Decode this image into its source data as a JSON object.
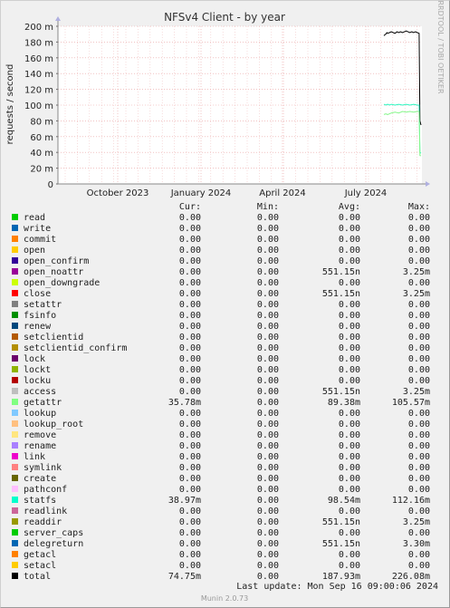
{
  "chart_data": {
    "type": "line",
    "title": "NFSv4 Client - by year",
    "ylabel": "requests / second",
    "side_label": "RRDTOOL / TOBI OETIKER",
    "ylim": [
      0,
      200
    ],
    "y_ticks": [
      "0",
      "20 m",
      "40 m",
      "60 m",
      "80 m",
      "100 m",
      "120 m",
      "140 m",
      "160 m",
      "180 m",
      "200 m"
    ],
    "x_ticks": [
      "October 2023",
      "January 2024",
      "April 2024",
      "July 2024"
    ],
    "grid": true,
    "series": [
      {
        "name": "total",
        "color": "#000000",
        "points": [
          [
            0.0,
            188
          ],
          [
            0.02,
            189
          ],
          [
            0.05,
            190
          ],
          [
            0.08,
            192
          ],
          [
            0.1,
            191
          ],
          [
            0.15,
            192
          ],
          [
            0.2,
            193
          ],
          [
            0.25,
            192
          ],
          [
            0.3,
            191
          ],
          [
            0.35,
            193
          ],
          [
            0.4,
            192
          ],
          [
            0.45,
            193
          ],
          [
            0.5,
            192
          ],
          [
            0.55,
            193
          ],
          [
            0.6,
            194
          ],
          [
            0.65,
            193
          ],
          [
            0.7,
            192
          ],
          [
            0.75,
            193
          ],
          [
            0.8,
            192
          ],
          [
            0.85,
            193
          ],
          [
            0.9,
            192
          ],
          [
            0.95,
            191
          ],
          [
            0.97,
            80
          ],
          [
            1.0,
            74.75
          ]
        ]
      },
      {
        "name": "statfs",
        "color": "#2cf6c0",
        "points": [
          [
            0.0,
            101
          ],
          [
            0.05,
            100
          ],
          [
            0.1,
            101
          ],
          [
            0.15,
            100
          ],
          [
            0.2,
            101
          ],
          [
            0.3,
            100
          ],
          [
            0.4,
            101
          ],
          [
            0.5,
            100
          ],
          [
            0.6,
            101
          ],
          [
            0.7,
            100
          ],
          [
            0.8,
            101
          ],
          [
            0.9,
            100
          ],
          [
            0.95,
            100
          ],
          [
            0.97,
            40
          ],
          [
            1.0,
            38.97
          ]
        ]
      },
      {
        "name": "getattr",
        "color": "#86f68a",
        "points": [
          [
            0.0,
            88
          ],
          [
            0.05,
            89
          ],
          [
            0.1,
            88
          ],
          [
            0.2,
            90
          ],
          [
            0.3,
            91
          ],
          [
            0.4,
            90
          ],
          [
            0.5,
            92
          ],
          [
            0.6,
            91
          ],
          [
            0.7,
            92
          ],
          [
            0.8,
            91
          ],
          [
            0.9,
            92
          ],
          [
            0.95,
            92
          ],
          [
            0.97,
            36
          ],
          [
            1.0,
            35.78
          ]
        ]
      }
    ],
    "legend_headers": [
      "Cur:",
      "Min:",
      "Avg:",
      "Max:"
    ],
    "legend": [
      {
        "name": "read",
        "color": "#00cc00",
        "cur": "0.00",
        "min": "0.00",
        "avg": "0.00",
        "max": "0.00"
      },
      {
        "name": "write",
        "color": "#0066b3",
        "cur": "0.00",
        "min": "0.00",
        "avg": "0.00",
        "max": "0.00"
      },
      {
        "name": "commit",
        "color": "#ff8000",
        "cur": "0.00",
        "min": "0.00",
        "avg": "0.00",
        "max": "0.00"
      },
      {
        "name": "open",
        "color": "#ffcc00",
        "cur": "0.00",
        "min": "0.00",
        "avg": "0.00",
        "max": "0.00"
      },
      {
        "name": "open_confirm",
        "color": "#330099",
        "cur": "0.00",
        "min": "0.00",
        "avg": "0.00",
        "max": "0.00"
      },
      {
        "name": "open_noattr",
        "color": "#990099",
        "cur": "0.00",
        "min": "0.00",
        "avg": "551.15n",
        "max": "3.25m"
      },
      {
        "name": "open_downgrade",
        "color": "#ccff00",
        "cur": "0.00",
        "min": "0.00",
        "avg": "0.00",
        "max": "0.00"
      },
      {
        "name": "close",
        "color": "#ff0000",
        "cur": "0.00",
        "min": "0.00",
        "avg": "551.15n",
        "max": "3.25m"
      },
      {
        "name": "setattr",
        "color": "#808080",
        "cur": "0.00",
        "min": "0.00",
        "avg": "0.00",
        "max": "0.00"
      },
      {
        "name": "fsinfo",
        "color": "#008f00",
        "cur": "0.00",
        "min": "0.00",
        "avg": "0.00",
        "max": "0.00"
      },
      {
        "name": "renew",
        "color": "#00487d",
        "cur": "0.00",
        "min": "0.00",
        "avg": "0.00",
        "max": "0.00"
      },
      {
        "name": "setclientid",
        "color": "#b35a00",
        "cur": "0.00",
        "min": "0.00",
        "avg": "0.00",
        "max": "0.00"
      },
      {
        "name": "setclientid_confirm",
        "color": "#b38f00",
        "cur": "0.00",
        "min": "0.00",
        "avg": "0.00",
        "max": "0.00"
      },
      {
        "name": "lock",
        "color": "#6b006b",
        "cur": "0.00",
        "min": "0.00",
        "avg": "0.00",
        "max": "0.00"
      },
      {
        "name": "lockt",
        "color": "#8fb300",
        "cur": "0.00",
        "min": "0.00",
        "avg": "0.00",
        "max": "0.00"
      },
      {
        "name": "locku",
        "color": "#b30000",
        "cur": "0.00",
        "min": "0.00",
        "avg": "0.00",
        "max": "0.00"
      },
      {
        "name": "access",
        "color": "#bebebe",
        "cur": "0.00",
        "min": "0.00",
        "avg": "551.15n",
        "max": "3.25m"
      },
      {
        "name": "getattr",
        "color": "#80ff80",
        "cur": "35.78m",
        "min": "0.00",
        "avg": "89.38m",
        "max": "105.57m"
      },
      {
        "name": "lookup",
        "color": "#80c9ff",
        "cur": "0.00",
        "min": "0.00",
        "avg": "0.00",
        "max": "0.00"
      },
      {
        "name": "lookup_root",
        "color": "#ffc080",
        "cur": "0.00",
        "min": "0.00",
        "avg": "0.00",
        "max": "0.00"
      },
      {
        "name": "remove",
        "color": "#ffe680",
        "cur": "0.00",
        "min": "0.00",
        "avg": "0.00",
        "max": "0.00"
      },
      {
        "name": "rename",
        "color": "#aa80ff",
        "cur": "0.00",
        "min": "0.00",
        "avg": "0.00",
        "max": "0.00"
      },
      {
        "name": "link",
        "color": "#ee00cc",
        "cur": "0.00",
        "min": "0.00",
        "avg": "0.00",
        "max": "0.00"
      },
      {
        "name": "symlink",
        "color": "#ff8080",
        "cur": "0.00",
        "min": "0.00",
        "avg": "0.00",
        "max": "0.00"
      },
      {
        "name": "create",
        "color": "#666600",
        "cur": "0.00",
        "min": "0.00",
        "avg": "0.00",
        "max": "0.00"
      },
      {
        "name": "pathconf",
        "color": "#ffbfff",
        "cur": "0.00",
        "min": "0.00",
        "avg": "0.00",
        "max": "0.00"
      },
      {
        "name": "statfs",
        "color": "#00ffcc",
        "cur": "38.97m",
        "min": "0.00",
        "avg": "98.54m",
        "max": "112.16m"
      },
      {
        "name": "readlink",
        "color": "#cc6699",
        "cur": "0.00",
        "min": "0.00",
        "avg": "0.00",
        "max": "0.00"
      },
      {
        "name": "readdir",
        "color": "#999900",
        "cur": "0.00",
        "min": "0.00",
        "avg": "551.15n",
        "max": "3.25m"
      },
      {
        "name": "server_caps",
        "color": "#00cc00",
        "cur": "0.00",
        "min": "0.00",
        "avg": "0.00",
        "max": "0.00"
      },
      {
        "name": "delegreturn",
        "color": "#0066b3",
        "cur": "0.00",
        "min": "0.00",
        "avg": "551.15n",
        "max": "3.30m"
      },
      {
        "name": "getacl",
        "color": "#ff8000",
        "cur": "0.00",
        "min": "0.00",
        "avg": "0.00",
        "max": "0.00"
      },
      {
        "name": "setacl",
        "color": "#ffcc00",
        "cur": "0.00",
        "min": "0.00",
        "avg": "0.00",
        "max": "0.00"
      },
      {
        "name": "total",
        "color": "#000000",
        "cur": "74.75m",
        "min": "0.00",
        "avg": "187.93m",
        "max": "226.08m"
      }
    ],
    "last_update": "Last update: Mon Sep 16 09:00:06 2024",
    "footer": "Munin 2.0.73"
  }
}
